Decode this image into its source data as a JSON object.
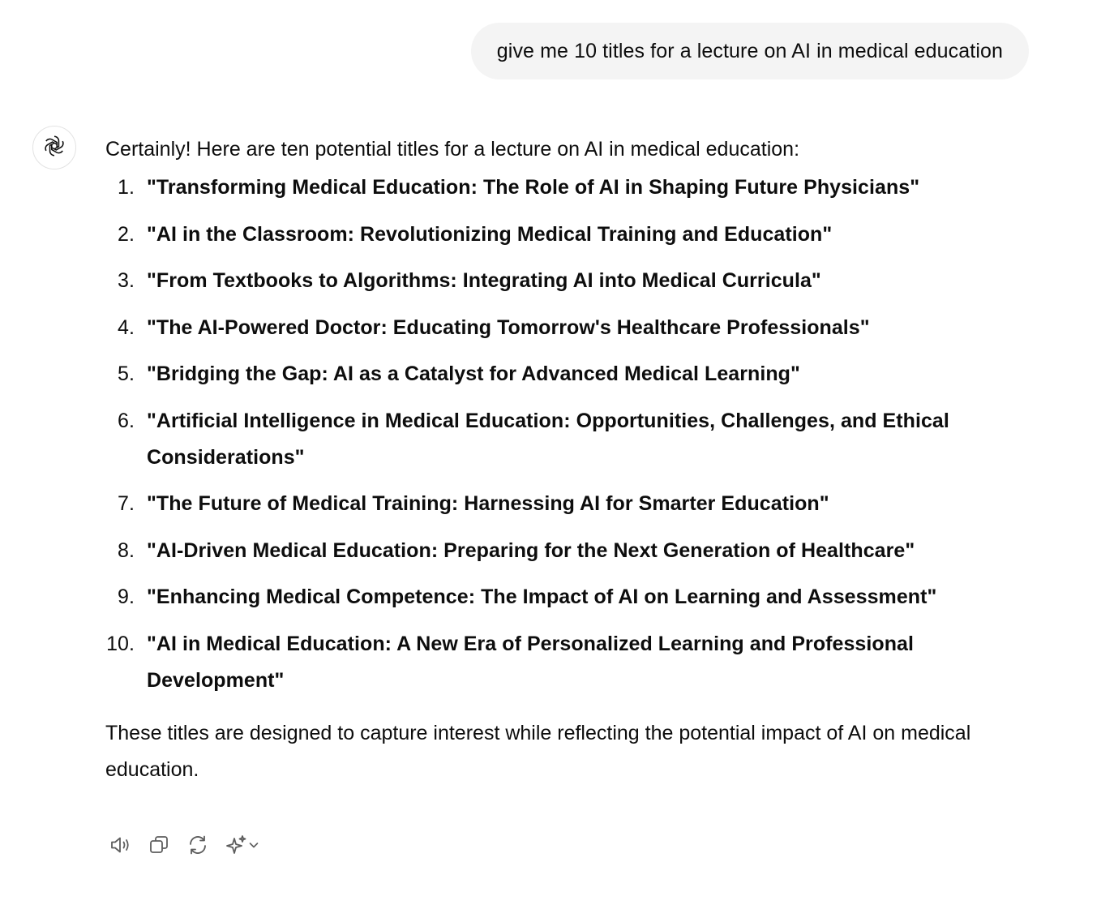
{
  "user_message": {
    "text": "give me 10 titles for a lecture on AI in medical education"
  },
  "assistant": {
    "avatar_icon": "openai-logo-icon",
    "intro": "Certainly! Here are ten potential titles for a lecture on AI in medical education:",
    "items": [
      {
        "number": "1.",
        "text": "\"Transforming Medical Education: The Role of AI in Shaping Future Physicians\""
      },
      {
        "number": "2.",
        "text": "\"AI in the Classroom: Revolutionizing Medical Training and Education\""
      },
      {
        "number": "3.",
        "text": "\"From Textbooks to Algorithms: Integrating AI into Medical Curricula\""
      },
      {
        "number": "4.",
        "text": "\"The AI-Powered Doctor: Educating Tomorrow's Healthcare Professionals\""
      },
      {
        "number": "5.",
        "text": "\"Bridging the Gap: AI as a Catalyst for Advanced Medical Learning\""
      },
      {
        "number": "6.",
        "text": "\"Artificial Intelligence in Medical Education: Opportunities, Challenges, and Ethical Considerations\""
      },
      {
        "number": "7.",
        "text": "\"The Future of Medical Training: Harnessing AI for Smarter Education\""
      },
      {
        "number": "8.",
        "text": "\"AI-Driven Medical Education: Preparing for the Next Generation of Healthcare\""
      },
      {
        "number": "9.",
        "text": "\"Enhancing Medical Competence: The Impact of AI on Learning and Assessment\""
      },
      {
        "number": "10.",
        "text": "\"AI in Medical Education: A New Era of Personalized Learning and Professional Development\""
      }
    ],
    "outro": "These titles are designed to capture interest while reflecting the potential impact of AI on medical education."
  },
  "toolbar": {
    "icons": [
      "read-aloud-icon",
      "copy-icon",
      "regenerate-icon",
      "switch-model-icon",
      "chevron-down-icon"
    ],
    "icon_color": "#5d5d5d"
  },
  "colors": {
    "text": "#0d0d0d",
    "user_bubble_bg": "#f4f4f4",
    "background": "#ffffff"
  }
}
